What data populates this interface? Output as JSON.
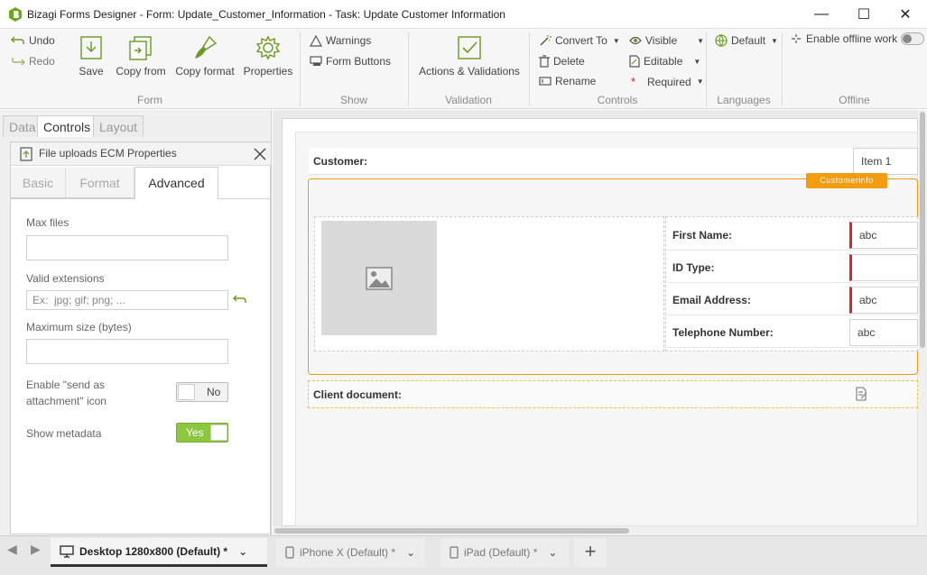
{
  "window": {
    "title": "Bizagi Forms Designer  - Form: Update_Customer_Information - Task:  Update Customer Information",
    "minimize": "—",
    "maximize": "☐",
    "close": "✕"
  },
  "ribbon": {
    "undo": "Undo",
    "redo": "Redo",
    "save": "Save",
    "copy_from": "Copy from",
    "copy_format": "Copy format",
    "properties": "Properties",
    "group_form": "Form",
    "warnings": "Warnings",
    "form_buttons": "Form Buttons",
    "group_show": "Show",
    "actions_validations": "Actions & Validations",
    "group_validation": "Validation",
    "convert_to": "Convert To",
    "delete": "Delete",
    "rename": "Rename",
    "visible": "Visible",
    "editable": "Editable",
    "required": "Required",
    "group_controls": "Controls",
    "default_lang": "Default",
    "group_languages": "Languages",
    "enable_offline": "Enable offline work",
    "group_offline": "Offline"
  },
  "left_panel": {
    "tabs": [
      "Data",
      "Controls",
      "Layout"
    ],
    "active_tab": "Controls",
    "props_title": "File uploads ECM Properties",
    "subtabs": [
      "Basic",
      "Format",
      "Advanced"
    ],
    "active_subtab": "Advanced",
    "max_files_label": "Max files",
    "valid_ext_label": "Valid extensions",
    "valid_ext_placeholder": "Ex:  jpg; gif; png; ...",
    "max_size_label": "Maximum size (bytes)",
    "send_attach_label_1": "Enable \"send as",
    "send_attach_label_2": "attachment\" icon",
    "send_attach_value": "No",
    "show_metadata_label": "Show metadata",
    "show_metadata_value": "Yes"
  },
  "form": {
    "customer_label": "Customer:",
    "customer_value": "Item 1",
    "group_badge": "Customerinfo",
    "fields": [
      {
        "label": "First Name:",
        "value": "abc",
        "required": true
      },
      {
        "label": "ID Type:",
        "value": "",
        "required": true
      },
      {
        "label": "Email Address:",
        "value": "abc",
        "required": true
      },
      {
        "label": "Telephone Number:",
        "value": "abc",
        "required": false
      }
    ],
    "client_doc_label": "Client document:"
  },
  "devices": {
    "desktop": "Desktop 1280x800 (Default) *",
    "iphone": "iPhone X (Default) *",
    "ipad": "iPad (Default) *",
    "add": "+"
  },
  "colors": {
    "accent_orange": "#f39c12",
    "required_red": "#d9262c",
    "toggle_green": "#8dc63f",
    "icon_green": "#6a9a1f"
  }
}
